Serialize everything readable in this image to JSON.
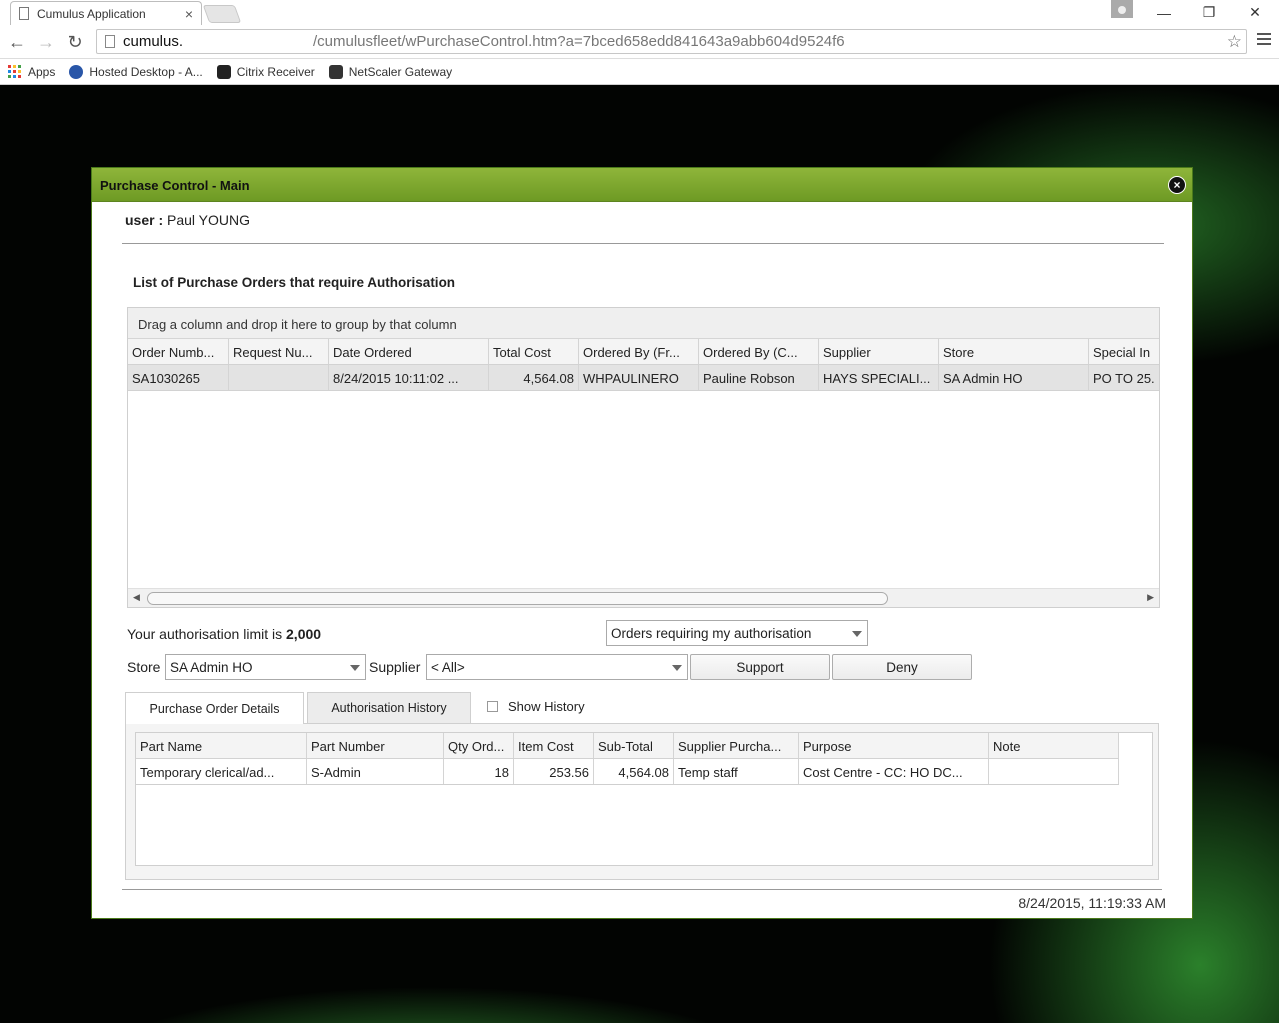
{
  "browser": {
    "tab_title": "Cumulus Application",
    "tab_close": "×",
    "url_host": "cumulus.",
    "url_path": "/cumulusfleet/wPurchaseControl.htm?a=7bced658edd841643a9abb604d9524f6",
    "bookmarks": [
      {
        "label": "Apps",
        "icon": "apps-grid-icon"
      },
      {
        "label": "Hosted Desktop - A...",
        "icon": "globe-icon"
      },
      {
        "label": "Citrix Receiver",
        "icon": "citrix-icon"
      },
      {
        "label": "NetScaler Gateway",
        "icon": "netscaler-icon"
      }
    ],
    "window_controls": {
      "minimize": "—",
      "restore": "❐",
      "close": "✕"
    }
  },
  "dialog": {
    "title": "Purchase Control - Main",
    "close_glyph": "×",
    "user_label": "user :",
    "user_name": "Paul YOUNG",
    "section_title": "List of Purchase Orders that require Authorisation",
    "group_hint": "Drag a column and drop it here to group by that column",
    "orders_grid": {
      "columns": [
        "Order Numb...",
        "Request Nu...",
        "Date Ordered",
        "Total Cost",
        "Ordered By (Fr...",
        "Ordered By (C...",
        "Supplier",
        "Store",
        "Special In"
      ],
      "rows": [
        [
          "SA1030265",
          "",
          "8/24/2015 10:11:02 ...",
          "4,564.08",
          "WHPAULINERO",
          "Pauline Robson",
          "HAYS SPECIALI...",
          "SA Admin HO",
          "PO TO 25."
        ]
      ]
    },
    "auth_limit_text": "Your authorisation limit is",
    "auth_limit_value": "2,000",
    "filter_select": "Orders requiring my authorisation",
    "store_label": "Store",
    "store_value": "SA Admin HO",
    "supplier_label": "Supplier",
    "supplier_value": "< All>",
    "support_button": "Support",
    "deny_button": "Deny",
    "tabs": [
      "Purchase Order Details",
      "Authorisation History"
    ],
    "show_history_label": "Show History",
    "details_grid": {
      "columns": [
        "Part Name",
        "Part Number",
        "Qty Ord...",
        "Item Cost",
        "Sub-Total",
        "Supplier Purcha...",
        "Purpose",
        "Note"
      ],
      "rows": [
        [
          "Temporary clerical/ad...",
          "S-Admin",
          "18",
          "253.56",
          "4,564.08",
          "Temp staff",
          "Cost Centre - CC: HO DC...",
          ""
        ]
      ]
    },
    "timestamp": "8/24/2015, 11:19:33 AM"
  }
}
